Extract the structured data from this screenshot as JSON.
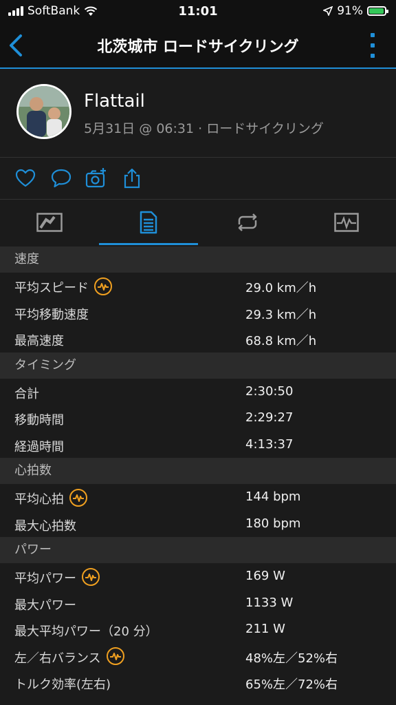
{
  "status": {
    "carrier": "SoftBank",
    "time": "11:01",
    "battery": "91%",
    "battery_level": 0.91
  },
  "nav": {
    "title": "北茨城市 ロードサイクリング"
  },
  "profile": {
    "name": "Flattail",
    "meta": "5月31日 @ 06:31 · ロードサイクリング"
  },
  "colors": {
    "accent": "#1f8fd8",
    "badge": "#f0a020",
    "section_bg": "#2b2b2b"
  },
  "actions": [
    "heart-icon",
    "comment-icon",
    "add-photo-icon",
    "share-icon"
  ],
  "tabs": [
    "map-tab",
    "stats-tab",
    "laps-tab",
    "chart-tab"
  ],
  "sections": {
    "speed": {
      "title": "速度",
      "rows": [
        {
          "label": "平均スピード",
          "value": "29.0 km／h"
        },
        {
          "label": "平均移動速度",
          "value": "29.3 km／h"
        },
        {
          "label": "最高速度",
          "value": "68.8 km／h"
        }
      ]
    },
    "timing": {
      "title": "タイミング",
      "rows": [
        {
          "label": "合計",
          "value": "2:30:50"
        },
        {
          "label": "移動時間",
          "value": "2:29:27"
        },
        {
          "label": "経過時間",
          "value": "4:13:37"
        }
      ]
    },
    "heart": {
      "title": "心拍数",
      "rows": [
        {
          "label": "平均心拍",
          "value": "144 bpm"
        },
        {
          "label": "最大心拍数",
          "value": "180 bpm"
        }
      ]
    },
    "power": {
      "title": "パワー",
      "rows": [
        {
          "label": "平均パワー",
          "value": "169 W"
        },
        {
          "label": "最大パワー",
          "value": "1133 W"
        },
        {
          "label": "最大平均パワー（20 分）",
          "value": "211 W"
        },
        {
          "label": "左／右バランス",
          "value": "48%左／52%右"
        },
        {
          "label": "トルク効率(左右)",
          "value": "65%左／72%右"
        }
      ]
    }
  }
}
